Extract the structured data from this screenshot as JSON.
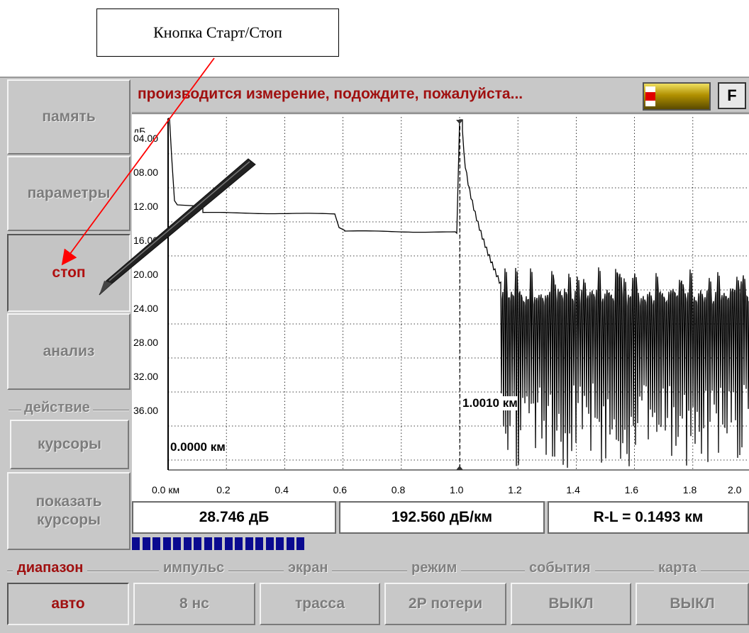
{
  "callout": {
    "text": "Кнопка Старт/Стоп"
  },
  "status": {
    "message": "производится измерение, подождите, пожалуйста...",
    "f_label": "F"
  },
  "side_buttons": {
    "memory": "память",
    "parameters": "параметры",
    "stop": "стоп",
    "analysis": "анализ",
    "action_group": "действие",
    "cursors": "курсоры",
    "show_cursors_line1": "показать",
    "show_cursors_line2": "курсоры"
  },
  "plot": {
    "y_unit": "дБ",
    "y_ticks": [
      "04.00",
      "08.00",
      "12.00",
      "16.00",
      "20.00",
      "24.00",
      "28.00",
      "32.00",
      "36.00"
    ],
    "x_ticks": [
      "0.0 км",
      "0.2",
      "0.4",
      "0.6",
      "0.8",
      "1.0",
      "1.2",
      "1.4",
      "1.6",
      "1.8",
      "2.0"
    ],
    "cursor_left_label": "0.0000 км",
    "cursor_right_label": "1.0010 км",
    "cursor_left_km": 0.0,
    "cursor_right_km": 1.001
  },
  "readouts": {
    "loss": "28.746 дБ",
    "attenuation": "192.560 дБ/км",
    "distance": "R-L = 0.1493 км"
  },
  "progress": {
    "filled_segments": 17
  },
  "bottom": {
    "range_label": "диапазон",
    "range_value": "авто",
    "pulse_label": "импульс",
    "pulse_value": "8 нс",
    "screen_label": "экран",
    "screen_value": "трасса",
    "mode_label": "режим",
    "mode_value": "2Р потери",
    "events_label": "события",
    "events_value": "ВЫКЛ",
    "map_label": "карта",
    "map_value": "ВЫКЛ"
  },
  "colors": {
    "active_text": "#a01010",
    "progress": "#0a0a90",
    "annotation_arrow": "#ff0000",
    "indicator_fill": "#c8a800"
  }
}
